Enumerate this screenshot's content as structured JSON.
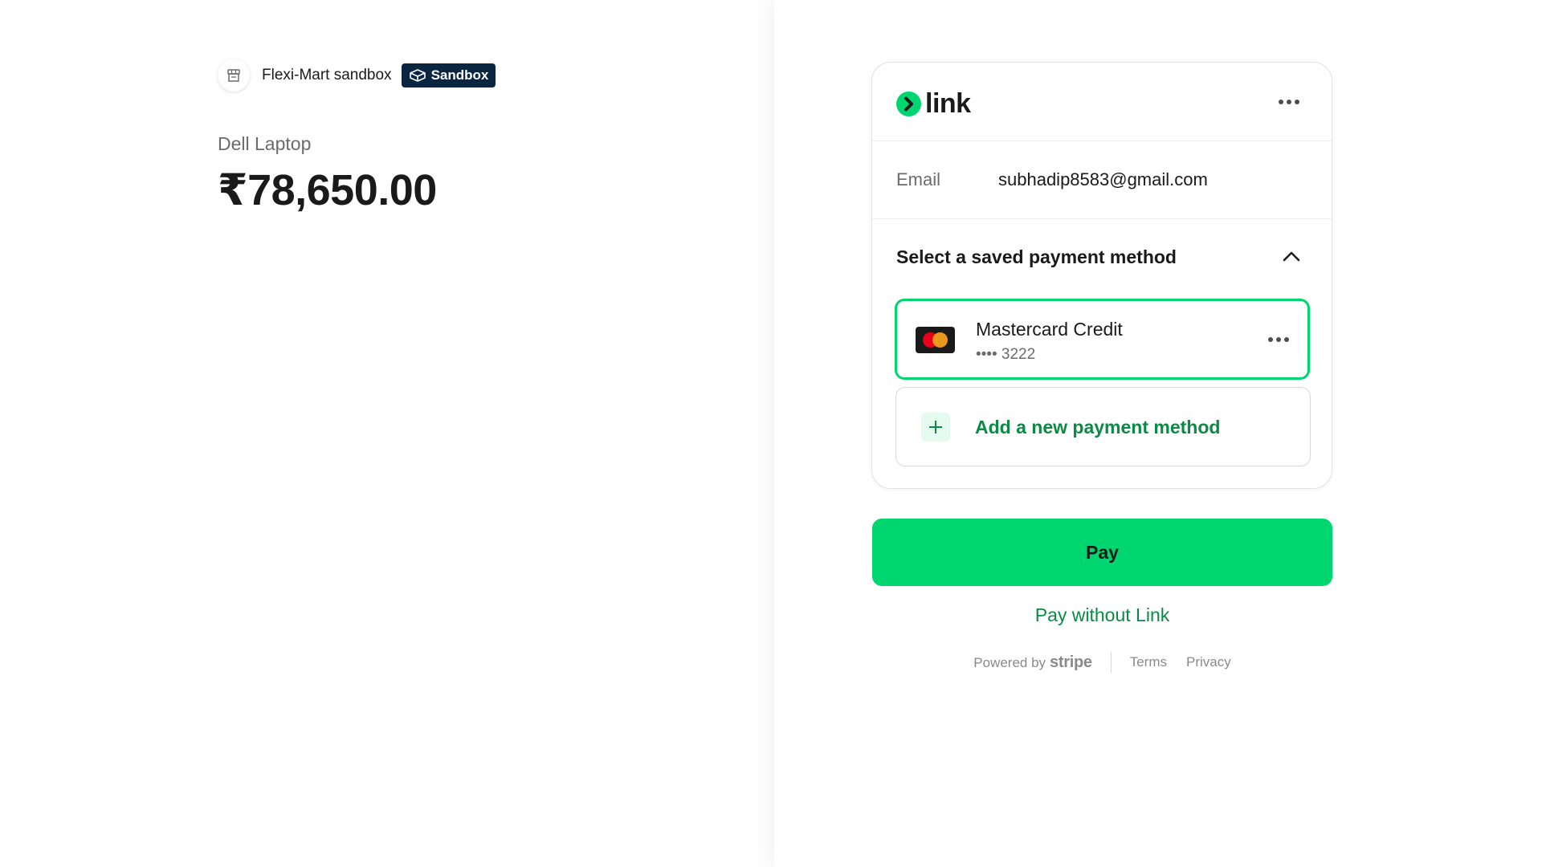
{
  "merchant": {
    "name": "Flexi-Mart sandbox",
    "badge": "Sandbox",
    "logo_icon": "store-icon"
  },
  "product": {
    "name": "Dell Laptop",
    "price": "₹78,650.00"
  },
  "link": {
    "brand": "link",
    "email_label": "Email",
    "email_value": "subhadip8583@gmail.com",
    "section_title": "Select a saved payment method",
    "saved_card": {
      "title": "Mastercard Credit",
      "last4": "•••• 3222"
    },
    "add_method_label": "Add a new payment method"
  },
  "actions": {
    "pay_label": "Pay",
    "pay_without_label": "Pay without Link"
  },
  "footer": {
    "powered_by": "Powered by",
    "stripe": "stripe",
    "terms": "Terms",
    "privacy": "Privacy"
  },
  "colors": {
    "accent_green": "#00d66f",
    "link_text_green": "#0a8a44",
    "badge_navy": "#0a2540"
  }
}
